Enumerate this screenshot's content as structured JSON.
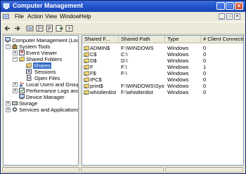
{
  "window": {
    "title": "Computer Management",
    "controls": {
      "minimize": "_",
      "maximize": "□",
      "close": "×"
    },
    "colors": {
      "titlebar": "#2355cc",
      "selection": "#316ac5"
    }
  },
  "menubar": {
    "items": [
      "File",
      "Action",
      "View",
      "Window",
      "Help"
    ],
    "mdi_controls": {
      "minimize": "_",
      "restore": "▫",
      "close": "×"
    }
  },
  "toolbar": {
    "buttons": [
      "back-arrow-icon",
      "forward-arrow-icon",
      "up-folder-icon",
      "show-hide-tree-icon",
      "properties-icon",
      "export-list-icon",
      "help-icon"
    ]
  },
  "tree": {
    "items": [
      {
        "label": "Computer Management (Local)",
        "icon": "computer-icon"
      },
      {
        "label": "System Tools",
        "icon": "tools-icon",
        "expander": "−"
      },
      {
        "label": "Event Viewer",
        "icon": "event-viewer-icon",
        "expander": "+"
      },
      {
        "label": "Shared Folders",
        "icon": "shared-folders-icon",
        "expander": "−"
      },
      {
        "label": "Shares",
        "icon": "share-folder-icon",
        "selected": true
      },
      {
        "label": "Sessions",
        "icon": "sessions-icon"
      },
      {
        "label": "Open Files",
        "icon": "open-files-icon"
      },
      {
        "label": "Local Users and Groups",
        "icon": "users-icon",
        "expander": "+"
      },
      {
        "label": "Performance Logs and Alerts",
        "icon": "performance-icon",
        "expander": "+"
      },
      {
        "label": "Device Manager",
        "icon": "device-manager-icon"
      },
      {
        "label": "Storage",
        "icon": "storage-icon",
        "expander": "+"
      },
      {
        "label": "Services and Applications",
        "icon": "services-icon",
        "expander": "+"
      }
    ]
  },
  "list": {
    "columns": [
      "Shared F...",
      "Shared Path",
      "Type",
      "# Client Connections"
    ],
    "rows": [
      {
        "name": "ADMIN$",
        "path": "F:\\WINDOWS",
        "type": "Windows",
        "connections": "0"
      },
      {
        "name": "C$",
        "path": "C:\\",
        "type": "Windows",
        "connections": "0"
      },
      {
        "name": "D$",
        "path": "D:\\",
        "type": "Windows",
        "connections": "0"
      },
      {
        "name": "F",
        "path": "F:\\",
        "type": "Windows",
        "connections": "1"
      },
      {
        "name": "F$",
        "path": "F:\\",
        "type": "Windows",
        "connections": "0"
      },
      {
        "name": "IPC$",
        "path": "",
        "type": "Windows",
        "connections": "0"
      },
      {
        "name": "print$",
        "path": "F:\\WINDOWS\\Syst...",
        "type": "Windows",
        "connections": "0"
      },
      {
        "name": "whistlerdist",
        "path": "F:\\whistlerdist",
        "type": "Windows",
        "connections": "0"
      }
    ]
  }
}
